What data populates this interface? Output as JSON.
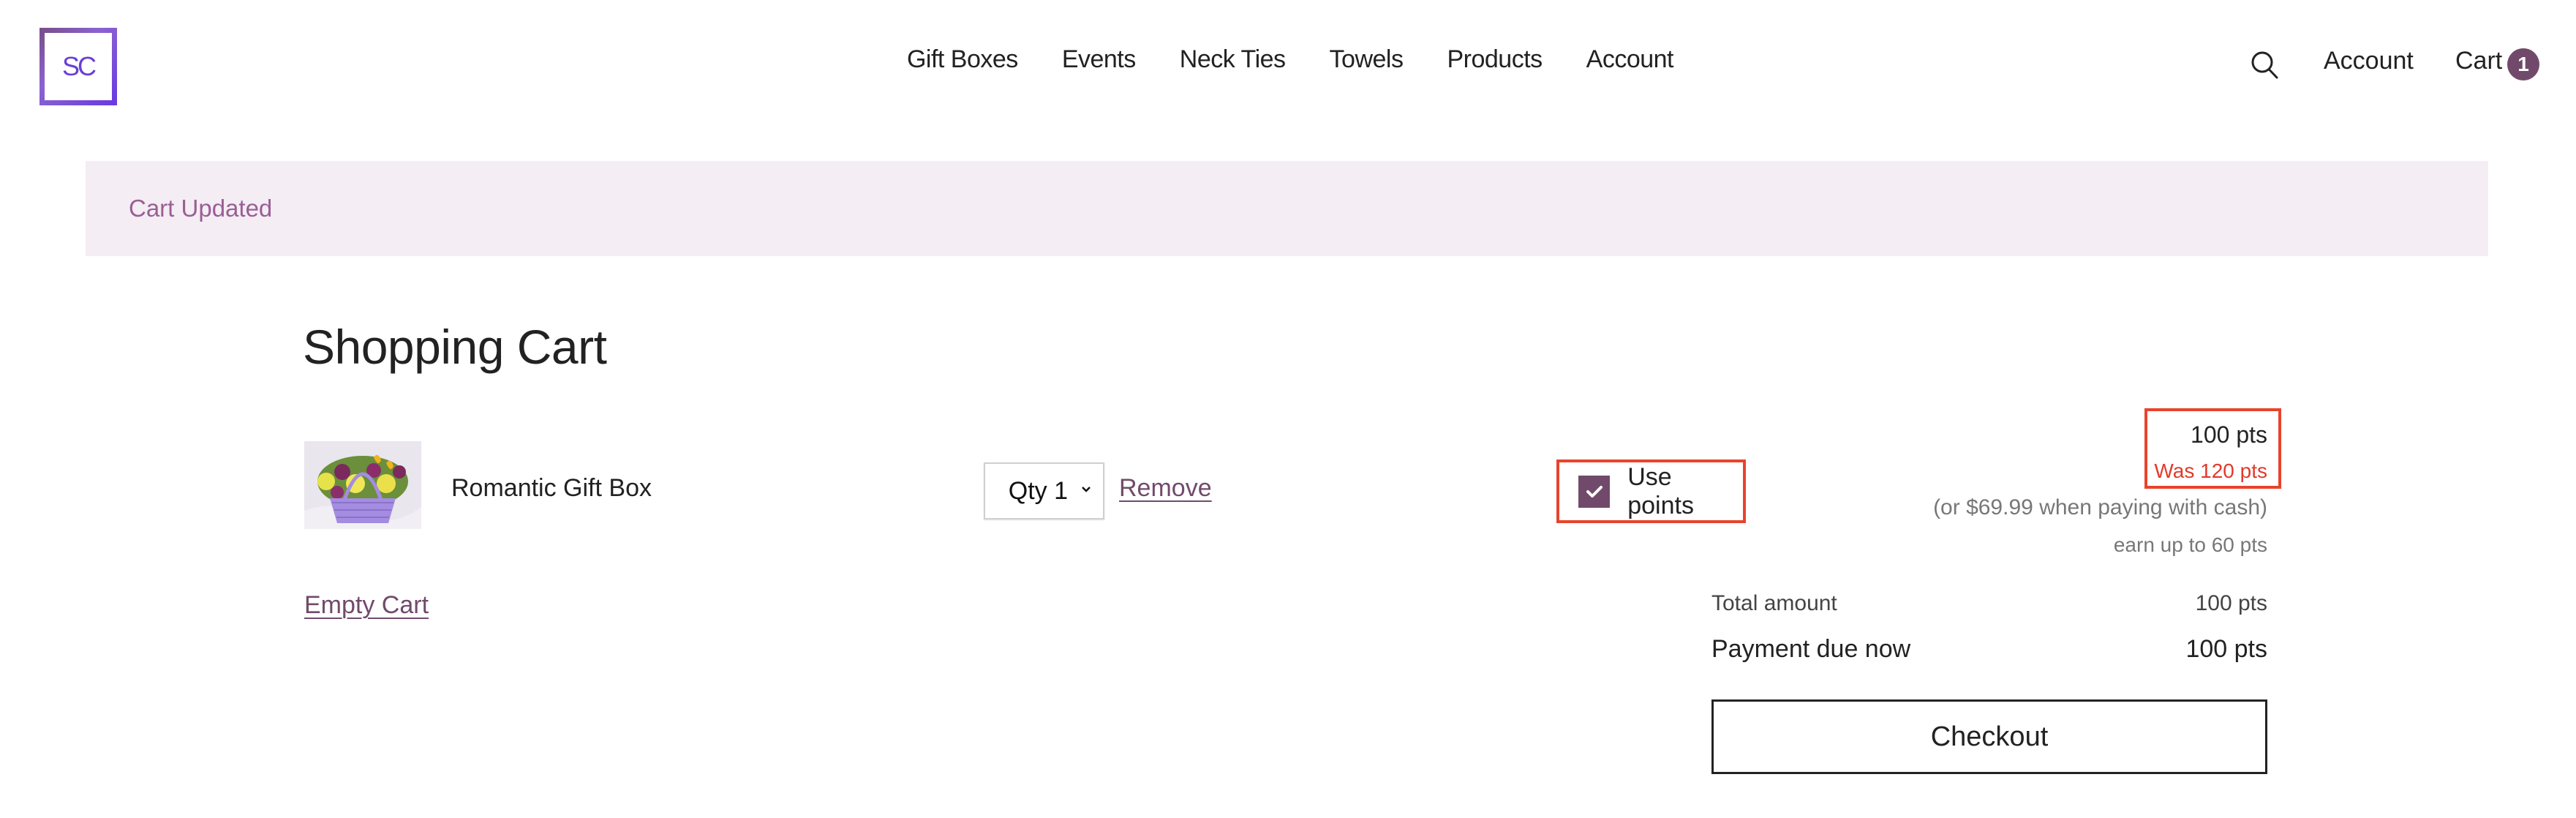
{
  "header": {
    "logo_text": "SC",
    "nav": [
      {
        "label": "Gift Boxes"
      },
      {
        "label": "Events"
      },
      {
        "label": "Neck Ties"
      },
      {
        "label": "Towels"
      },
      {
        "label": "Products"
      },
      {
        "label": "Account"
      }
    ],
    "search_icon": "search-icon",
    "account_label": "Account",
    "cart_label": "Cart",
    "cart_count": "1"
  },
  "banner": {
    "message": "Cart Updated"
  },
  "cart": {
    "title": "Shopping Cart",
    "items": [
      {
        "name": "Romantic Gift Box",
        "qty_label": "Qty 1",
        "remove_label": "Remove",
        "use_points_label": "Use points",
        "use_points_checked": true,
        "price_now": "100 pts",
        "price_was": "Was 120 pts",
        "price_cash": "(or $69.99 when paying with cash)",
        "earn_points": "earn up to 60 pts"
      }
    ],
    "empty_cart_label": "Empty Cart"
  },
  "summary": {
    "total_label": "Total amount",
    "total_value": "100 pts",
    "due_label": "Payment due now",
    "due_value": "100 pts",
    "checkout_label": "Checkout"
  },
  "colors": {
    "brand_purple": "#714a6b",
    "logo_purple": "#6a3ed6",
    "banner_bg": "#f4edf3",
    "banner_text": "#9a5e97",
    "highlight_red": "#e8442c",
    "was_price_red": "#e2392b"
  }
}
